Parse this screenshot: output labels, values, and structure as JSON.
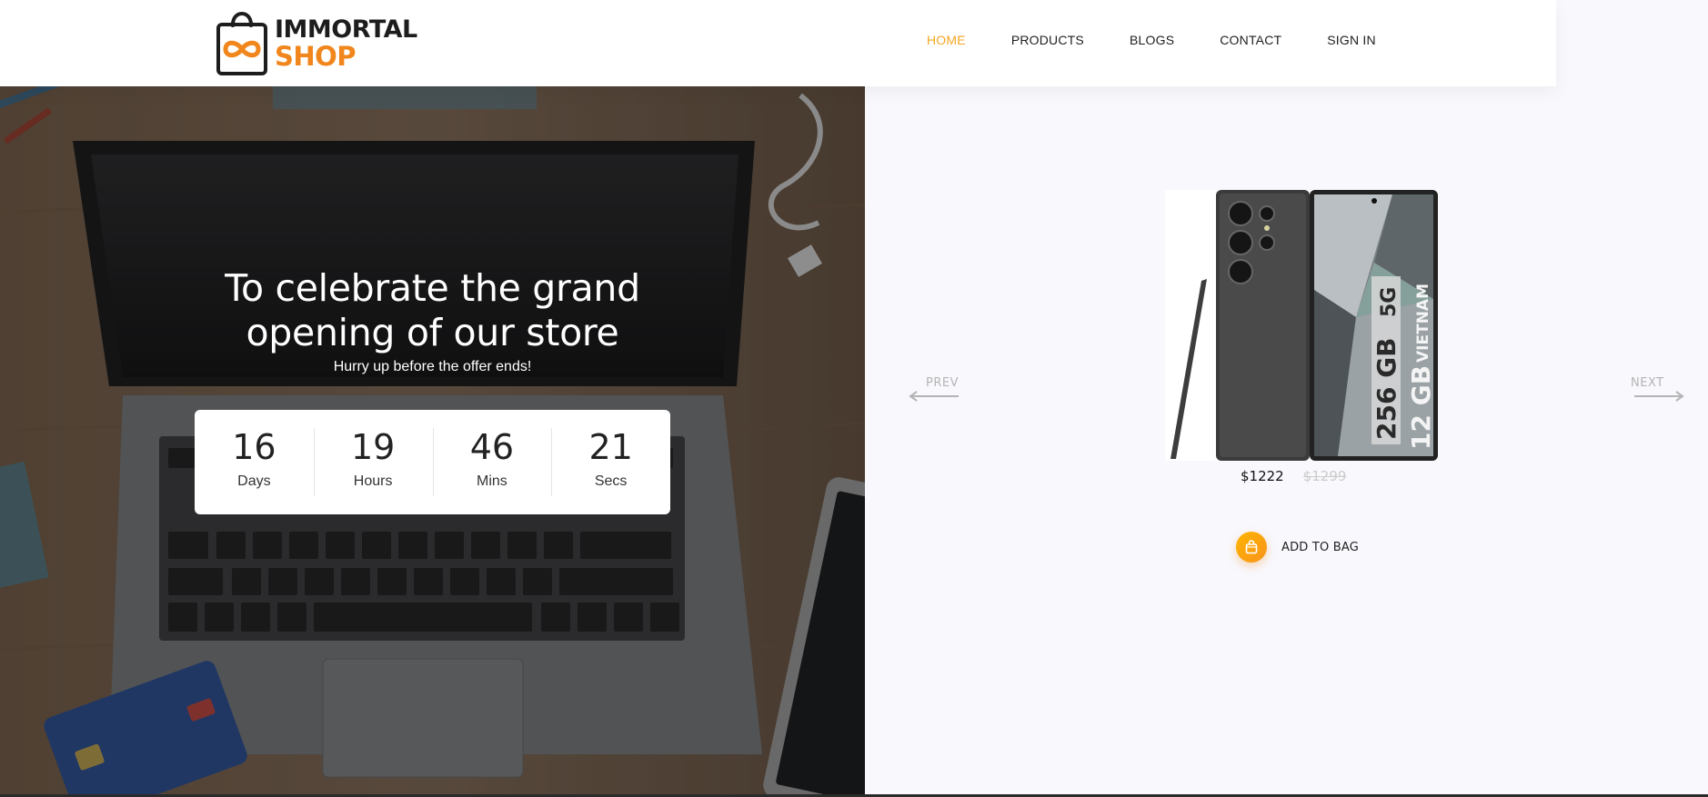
{
  "logo": {
    "line1": "IMMORTAL",
    "line2": "SHOP",
    "brand_color": "#f0861c"
  },
  "nav": {
    "home": "HOME",
    "products": "PRODUCTS",
    "blogs": "BLOGS",
    "contact": "CONTACT",
    "signin": "SIGN IN",
    "active_color": "#f5a623"
  },
  "hero": {
    "headline_line1": "To celebrate the grand",
    "headline_line2": "opening of our store",
    "subline": "Hurry up before the offer ends!",
    "countdown": {
      "days": "16",
      "days_label": "Days",
      "hours": "19",
      "hours_label": "Hours",
      "mins": "46",
      "mins_label": "Mins",
      "secs": "21",
      "secs_label": "Secs"
    }
  },
  "product": {
    "image_text_storage": "256 GB",
    "image_text_ram": "12 GB",
    "image_text_net": "5G",
    "image_text_region": "VIETNAM",
    "price": "$1222",
    "old_price": "$1299",
    "add_to_bag": "ADD TO BAG",
    "prev_label": "PREV",
    "next_label": "NEXT",
    "accent": "#f7941d"
  }
}
